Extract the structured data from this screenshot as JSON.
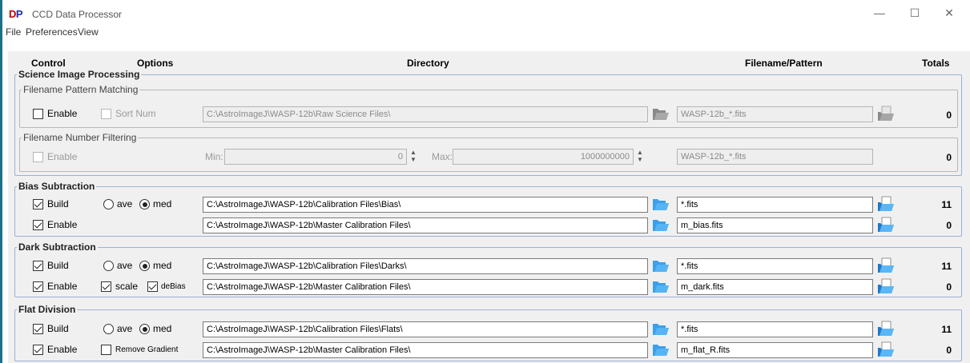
{
  "window": {
    "logo": "DP",
    "title": "CCD Data Processor",
    "minimize_icon": "—",
    "maximize_icon": "☐",
    "close_icon": "✕"
  },
  "menu": [
    "File",
    "Preferences",
    "View"
  ],
  "headers": {
    "control": "Control",
    "options": "Options",
    "directory": "Directory",
    "filename": "Filename/Pattern",
    "totals": "Totals"
  },
  "science": {
    "legend": "Science Image Processing",
    "pattern_matching": {
      "legend": "Filename Pattern Matching",
      "enable_label": "Enable",
      "enable_checked": false,
      "sortnum_label": "Sort Num",
      "sortnum_checked": false,
      "directory": "C:\\AstroImageJ\\WASP-12b\\Raw Science Files\\",
      "pattern": "WASP-12b_*.fits",
      "total": "0"
    },
    "number_filtering": {
      "legend": "Filename Number Filtering",
      "enable_label": "Enable",
      "enable_checked": false,
      "min_label": "Min:",
      "min_value": "0",
      "max_label": "Max:",
      "max_value": "1000000000",
      "pattern": "WASP-12b_*.fits",
      "total": "0"
    }
  },
  "bias": {
    "legend": "Bias Subtraction",
    "build_label": "Build",
    "build_checked": true,
    "ave_label": "ave",
    "med_label": "med",
    "selected": "med",
    "build_dir": "C:\\AstroImageJ\\WASP-12b\\Calibration Files\\Bias\\",
    "build_pattern": "*.fits",
    "build_total": "11",
    "enable_label": "Enable",
    "enable_checked": true,
    "enable_dir": "C:\\AstroImageJ\\WASP-12b\\Master Calibration Files\\",
    "enable_file": "m_bias.fits",
    "enable_total": "0"
  },
  "dark": {
    "legend": "Dark Subtraction",
    "build_label": "Build",
    "build_checked": true,
    "ave_label": "ave",
    "med_label": "med",
    "selected": "med",
    "build_dir": "C:\\AstroImageJ\\WASP-12b\\Calibration Files\\Darks\\",
    "build_pattern": "*.fits",
    "build_total": "11",
    "enable_label": "Enable",
    "enable_checked": true,
    "scale_label": "scale",
    "scale_checked": true,
    "debias_label": "deBias",
    "debias_checked": true,
    "enable_dir": "C:\\AstroImageJ\\WASP-12b\\Master Calibration Files\\",
    "enable_file": "m_dark.fits",
    "enable_total": "0"
  },
  "flat": {
    "legend": "Flat Division",
    "build_label": "Build",
    "build_checked": true,
    "ave_label": "ave",
    "med_label": "med",
    "selected": "med",
    "build_dir": "C:\\AstroImageJ\\WASP-12b\\Calibration Files\\Flats\\",
    "build_pattern": "*.fits",
    "build_total": "11",
    "enable_label": "Enable",
    "enable_checked": true,
    "gradient_label": "Remove Gradient",
    "gradient_checked": false,
    "enable_dir": "C:\\AstroImageJ\\WASP-12b\\Master Calibration Files\\",
    "enable_file": "m_flat_R.fits",
    "enable_total": "0"
  },
  "icons": {
    "folder_open": "folder-open-icon",
    "folder_disabled": "folder-disabled-icon",
    "file_open": "file-open-icon",
    "file_disabled": "file-disabled-icon"
  },
  "colors": {
    "logo_d": "#c00000",
    "logo_p": "#1a2fb0",
    "group_border": "#9db0d8",
    "folder_blue": "#2b8fe0"
  }
}
